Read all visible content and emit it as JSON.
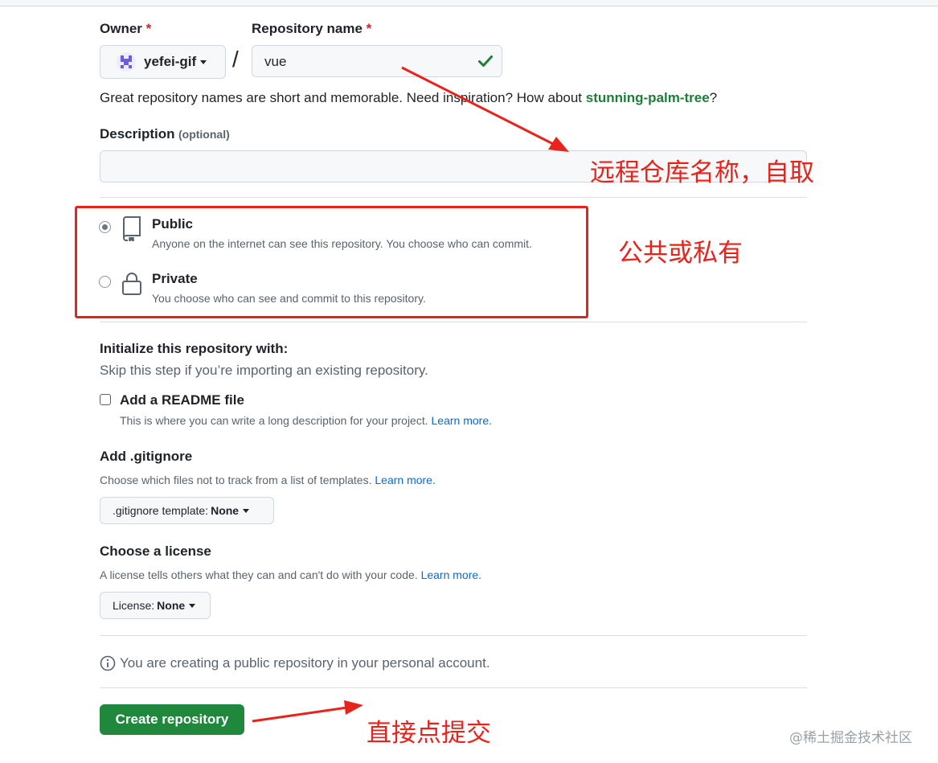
{
  "owner": {
    "label": "Owner",
    "required_mark": "*",
    "value": "yefei-gif"
  },
  "separator": "/",
  "repo_name": {
    "label": "Repository name",
    "required_mark": "*",
    "value": "vue"
  },
  "name_hint": {
    "prefix": "Great repository names are short and memorable. Need inspiration? How about ",
    "suggestion": "stunning-palm-tree",
    "suffix": "?"
  },
  "description": {
    "label": "Description",
    "optional": "(optional)",
    "value": ""
  },
  "visibility": {
    "public": {
      "title": "Public",
      "desc": "Anyone on the internet can see this repository. You choose who can commit.",
      "selected": true
    },
    "private": {
      "title": "Private",
      "desc": "You choose who can see and commit to this repository.",
      "selected": false
    }
  },
  "init": {
    "title": "Initialize this repository with:",
    "subtitle": "Skip this step if you’re importing an existing repository."
  },
  "readme": {
    "label": "Add a README file",
    "desc": "This is where you can write a long description for your project.",
    "link": "Learn more.",
    "checked": false
  },
  "gitignore": {
    "title": "Add .gitignore",
    "desc": "Choose which files not to track from a list of templates.",
    "link": "Learn more.",
    "button_prefix": ".gitignore template: ",
    "button_value": "None"
  },
  "license": {
    "title": "Choose a license",
    "desc": "A license tells others what they can and can't do with your code.",
    "link": "Learn more.",
    "button_prefix": "License: ",
    "button_value": "None"
  },
  "notice": "You are creating a public repository in your personal account.",
  "create_button": "Create repository",
  "annotations": {
    "repo_name_note": "远程仓库名称，自取",
    "visibility_note": "公共或私有",
    "submit_note": "直接点提交",
    "color": "#e8231b"
  },
  "watermark": "@稀土掘金技术社区",
  "colors": {
    "primary_button": "#1f883d",
    "link": "#0969da",
    "suggestion": "#1a7f37",
    "required": "#cf222e"
  }
}
